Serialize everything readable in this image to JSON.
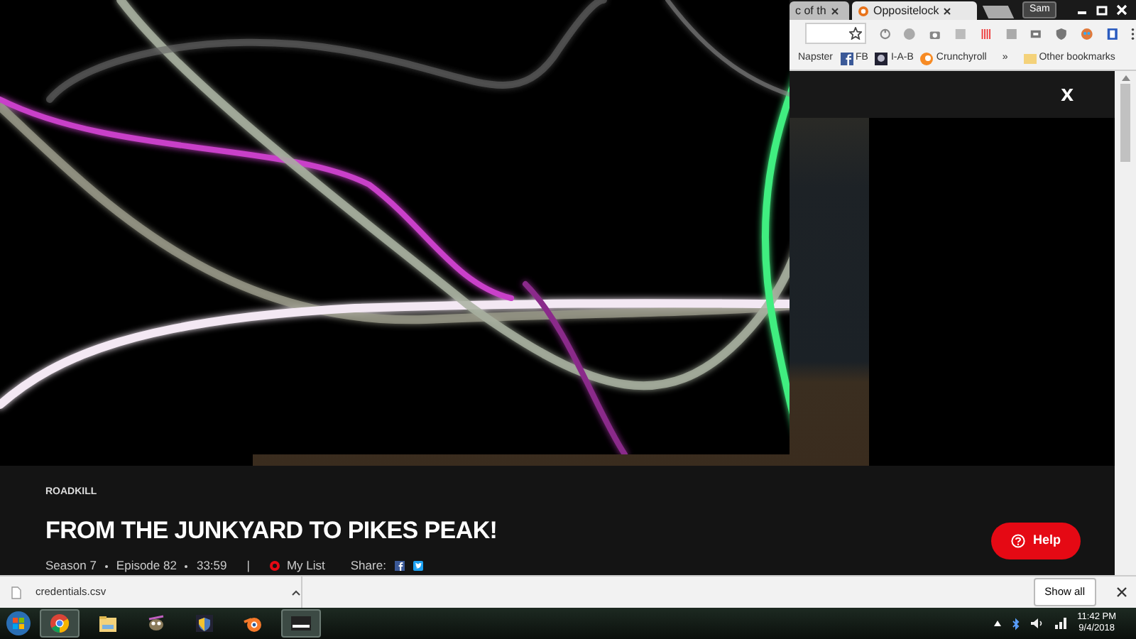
{
  "browser": {
    "tabs": [
      {
        "title": "c of th",
        "selected": false
      },
      {
        "title": "Oppositelock",
        "selected": true
      }
    ],
    "profile": "Sam",
    "bookmarks": [
      {
        "label": "Napster",
        "kind": "plain"
      },
      {
        "label": "FB",
        "kind": "facebook"
      },
      {
        "label": "I-A-B",
        "kind": "robot"
      },
      {
        "label": "Crunchyroll",
        "kind": "crunchyroll"
      }
    ],
    "bookmarks_more": "»",
    "other_bookmarks": "Other bookmarks"
  },
  "page": {
    "close": "x",
    "show": "ROADKILL",
    "title": "FROM THE JUNKYARD TO PIKES PEAK!",
    "meta": [
      "Season 7",
      "Episode 82",
      "33:59"
    ],
    "separator": "|",
    "my_list": "My List",
    "share": "Share:",
    "help": "Help"
  },
  "downloads": {
    "file": "credentials.csv",
    "show_all": "Show all"
  },
  "taskbar": {
    "apps": [
      {
        "kind": "chrome",
        "selected": true
      },
      {
        "kind": "folder",
        "selected": false
      },
      {
        "kind": "gimp",
        "selected": false
      },
      {
        "kind": "shield",
        "selected": false
      },
      {
        "kind": "blender",
        "selected": false
      },
      {
        "kind": "window",
        "selected": true
      }
    ],
    "time": "11:42 PM",
    "date": "9/4/2018"
  }
}
